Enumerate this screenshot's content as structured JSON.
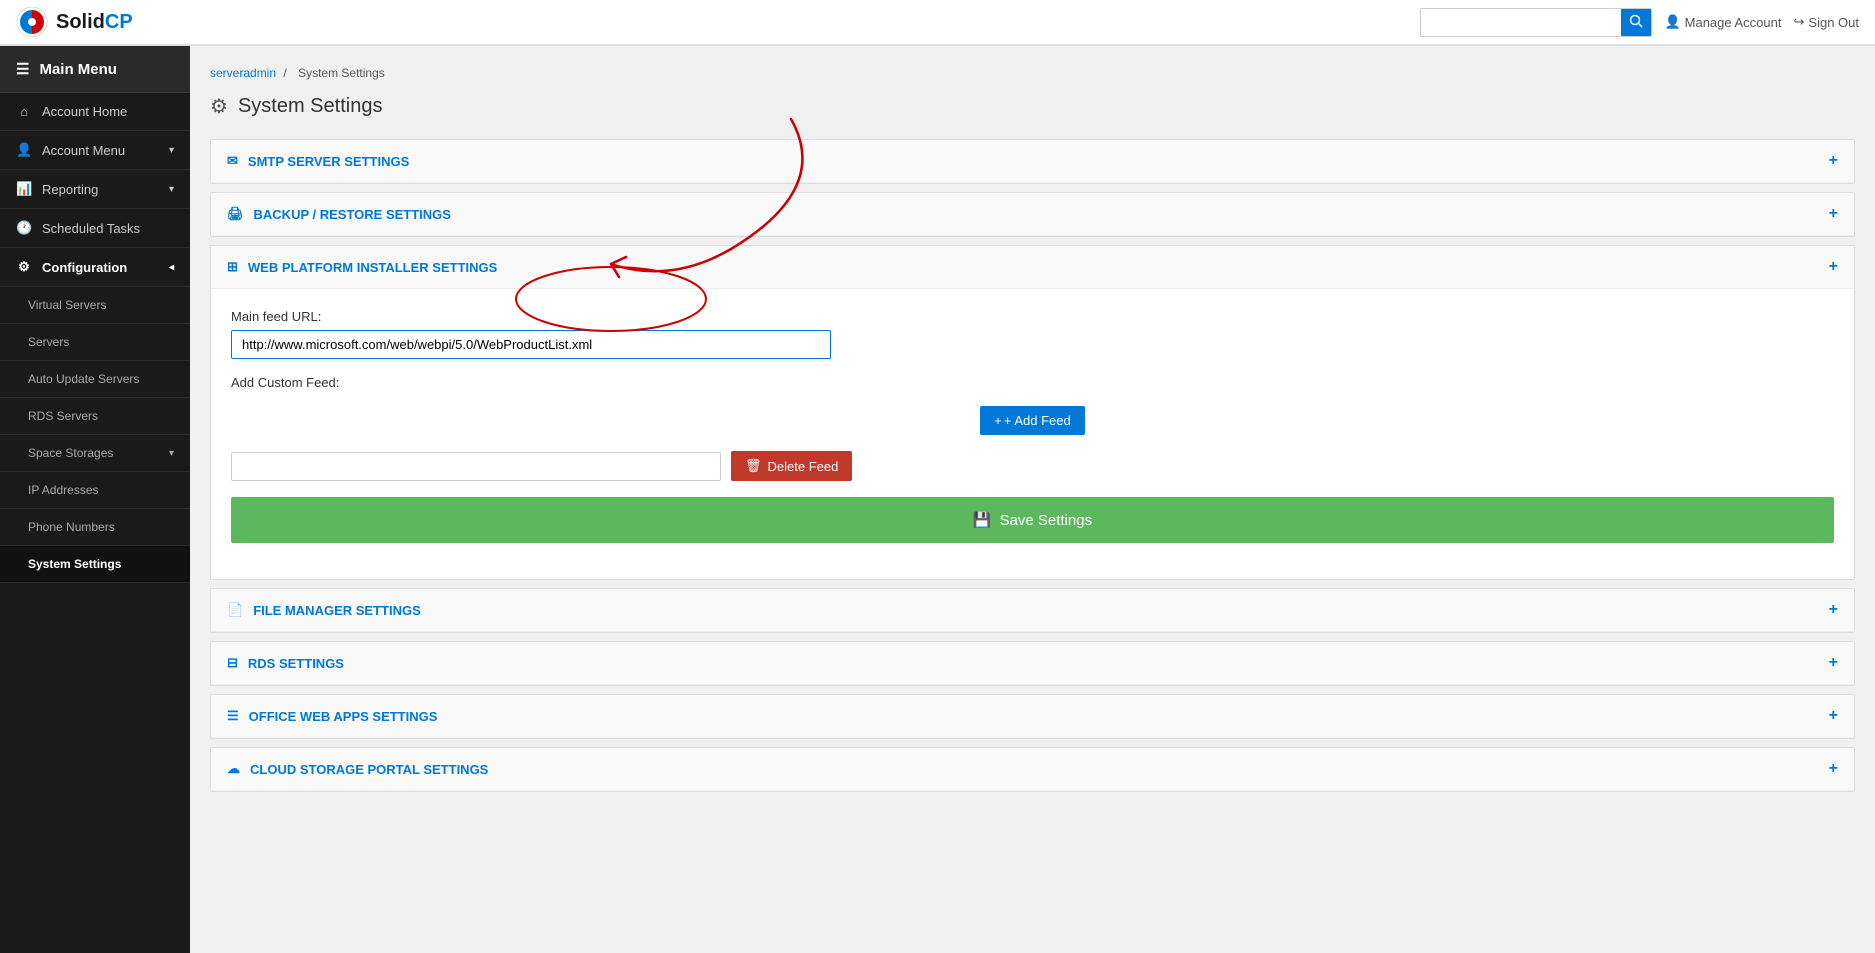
{
  "topnav": {
    "logo_solid": "Solid",
    "logo_cp": "CP",
    "search_placeholder": "",
    "manage_account": "Manage Account",
    "sign_out": "Sign Out"
  },
  "sidebar": {
    "header": "Main Menu",
    "items": [
      {
        "id": "account-home",
        "label": "Account Home",
        "icon": "⌂",
        "sub": false,
        "active": false
      },
      {
        "id": "account-menu",
        "label": "Account Menu",
        "icon": "👤",
        "sub": false,
        "active": false,
        "has_chevron": true
      },
      {
        "id": "reporting",
        "label": "Reporting",
        "icon": "📊",
        "sub": false,
        "active": false,
        "has_chevron": true
      },
      {
        "id": "scheduled-tasks",
        "label": "Scheduled Tasks",
        "icon": "🕐",
        "sub": false,
        "active": false
      },
      {
        "id": "configuration",
        "label": "Configuration",
        "icon": "⚙",
        "sub": false,
        "active": true,
        "has_chevron": true
      },
      {
        "id": "virtual-servers",
        "label": "Virtual Servers",
        "icon": "",
        "sub": true,
        "active": false
      },
      {
        "id": "servers",
        "label": "Servers",
        "icon": "",
        "sub": true,
        "active": false
      },
      {
        "id": "auto-update-servers",
        "label": "Auto Update Servers",
        "icon": "",
        "sub": true,
        "active": false
      },
      {
        "id": "rds-servers",
        "label": "RDS Servers",
        "icon": "",
        "sub": true,
        "active": false
      },
      {
        "id": "space-storages",
        "label": "Space Storages",
        "icon": "",
        "sub": true,
        "active": false,
        "has_chevron": true
      },
      {
        "id": "ip-addresses",
        "label": "IP Addresses",
        "icon": "",
        "sub": true,
        "active": false
      },
      {
        "id": "phone-numbers",
        "label": "Phone Numbers",
        "icon": "",
        "sub": true,
        "active": false
      },
      {
        "id": "system-settings",
        "label": "System Settings",
        "icon": "",
        "sub": true,
        "active": true,
        "highlighted": true
      }
    ]
  },
  "breadcrumb": {
    "parent": "serveradmin",
    "separator": "/",
    "current": "System Settings"
  },
  "page": {
    "title": "System Settings"
  },
  "panels": [
    {
      "id": "smtp",
      "icon": "✉",
      "label": "SMTP SERVER SETTINGS",
      "expanded": false
    },
    {
      "id": "backup",
      "icon": "🖨",
      "label": "BACKUP / RESTORE SETTINGS",
      "expanded": false
    },
    {
      "id": "webpi",
      "icon": "⊞",
      "label": "WEB PLATFORM INSTALLER SETTINGS",
      "expanded": true
    },
    {
      "id": "filemanager",
      "icon": "📄",
      "label": "FILE MANAGER SETTINGS",
      "expanded": false
    },
    {
      "id": "rds",
      "icon": "⊟",
      "label": "RDS SETTINGS",
      "expanded": false
    },
    {
      "id": "officewebapps",
      "icon": "☰",
      "label": "OFFICE WEB APPS SETTINGS",
      "expanded": false
    },
    {
      "id": "cloudstorage",
      "icon": "☁",
      "label": "CLOUD STORAGE PORTAL SETTINGS",
      "expanded": false
    }
  ],
  "webpi": {
    "main_feed_label": "Main feed URL:",
    "main_feed_value": "http://www.microsoft.com/web/webpi/5.0/WebProductList.xml",
    "add_custom_feed_label": "Add Custom Feed:",
    "add_feed_button": "+ Add Feed",
    "delete_feed_button": "Delete Feed",
    "save_settings_button": "Save Settings",
    "custom_feed_placeholder": ""
  }
}
